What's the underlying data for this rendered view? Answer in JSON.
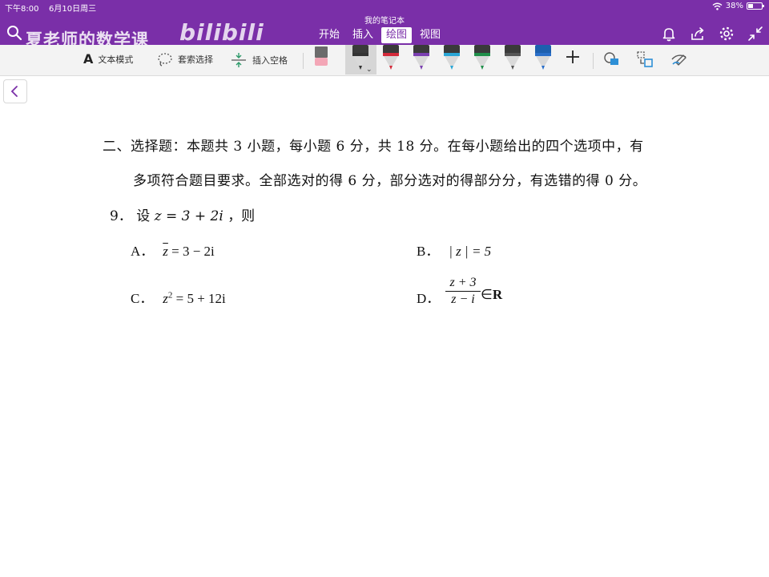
{
  "status_bar": {
    "time": "下午8:00",
    "date": "6月10日周三",
    "battery": "38%",
    "battery_fraction": 0.38
  },
  "window_title": "我的笔记本",
  "watermark": {
    "channel": "夏老师的数学课",
    "logo": "bilibili"
  },
  "tabs": [
    {
      "label": "开始",
      "active": false
    },
    {
      "label": "插入",
      "active": false
    },
    {
      "label": "绘图",
      "active": true
    },
    {
      "label": "视图",
      "active": false
    }
  ],
  "ribbon": {
    "text_mode_label": "文本模式",
    "lasso_label": "套索选择",
    "insert_space_label": "插入空格",
    "pens": [
      {
        "color": "#333333",
        "selected": true
      },
      {
        "color": "#d42a3a",
        "selected": false
      },
      {
        "color": "#7a3fb0",
        "selected": false
      },
      {
        "color": "#29a6d6",
        "selected": false
      },
      {
        "color": "#1f8f4a",
        "selected": false
      },
      {
        "color": "#555555",
        "selected": false
      },
      {
        "color": "#2a6fc9",
        "selected": false
      }
    ]
  },
  "colors": {
    "accent": "#7a2fa8",
    "ribbon_bg": "#f3f3f3"
  },
  "document": {
    "section_line1": "二、选择题：本题共 3 小题，每小题 6 分，共 18 分。在每小题给出的四个选项中，有",
    "section_line2": "多项符合题目要求。全部选对的得 6 分，部分选对的得部分分，有选错的得 0 分。",
    "question": {
      "number": "9．",
      "stem_prefix": "设",
      "stem_math": "z = 3 + 2i",
      "stem_suffix": "，则"
    },
    "options": {
      "A": {
        "label": "A．",
        "zbar": "z",
        "rest": " = 3 − 2i"
      },
      "B": {
        "label": "B．",
        "math": "| z | = 5"
      },
      "C": {
        "label": "C．",
        "z": "z",
        "exp": "2",
        "rest": " = 5 + 12i"
      },
      "D": {
        "label": "D．",
        "numerator": "z + 3",
        "denominator": "z − i",
        "rest": "∈",
        "set": "R"
      }
    }
  }
}
